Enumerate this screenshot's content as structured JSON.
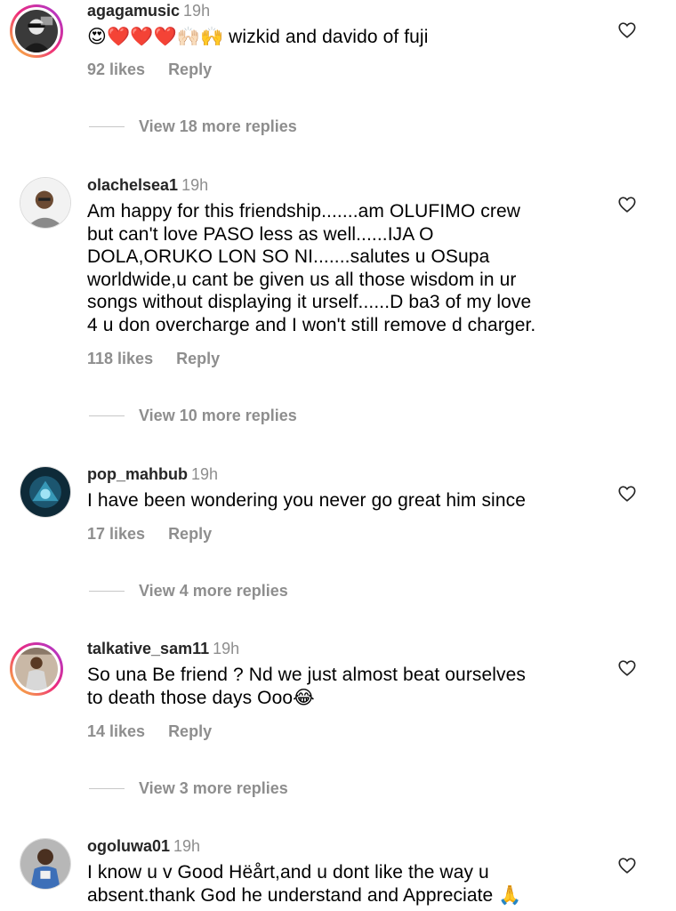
{
  "comments": [
    {
      "username": "agagamusic",
      "time": "19h",
      "text": "😍❤️❤️❤️🙌🏻🙌 wizkid and davido of fuji",
      "likes": "92 likes",
      "reply": "Reply",
      "view_replies": "View 18 more replies",
      "avatar_ring": "story"
    },
    {
      "username": "olachelsea1",
      "time": "19h",
      "text": "Am happy for this friendship.......am OLUFIMO crew\nbut can't love PASO less as well......IJA O\nDOLA,ORUKO LON SO NI.......salutes u OSupa\nworldwide,u cant be given us all those wisdom in ur\nsongs without displaying it urself......D ba3 of my love\n4 u don overcharge and I won't still remove d charger.",
      "likes": "118 likes",
      "reply": "Reply",
      "view_replies": "View 10 more replies",
      "avatar_ring": "plain"
    },
    {
      "username": "pop_mahbub",
      "time": "19h",
      "text": "I have been wondering you never go great him since",
      "likes": "17 likes",
      "reply": "Reply",
      "view_replies": "View 4 more replies",
      "avatar_ring": "plain"
    },
    {
      "username": "talkative_sam11",
      "time": "19h",
      "text": "So una Be friend ? Nd we just almost beat ourselves\nto death those days Ooo😂",
      "likes": "14 likes",
      "reply": "Reply",
      "view_replies": "View 3 more replies",
      "avatar_ring": "story"
    },
    {
      "username": "ogoluwa01",
      "time": "19h",
      "text": "I know u v Good Hëårt,and u dont like the way u\nabsent.thank God he understand and Appreciate 🙏",
      "likes": "",
      "reply": "",
      "view_replies": "",
      "avatar_ring": "plain"
    }
  ],
  "icons": {
    "like": "heart-outline-icon"
  },
  "colors": {
    "username": "#262626",
    "secondary": "#8e8e8e",
    "story_ring_start": "#f9ce34",
    "story_ring_end": "#a33ad9"
  }
}
